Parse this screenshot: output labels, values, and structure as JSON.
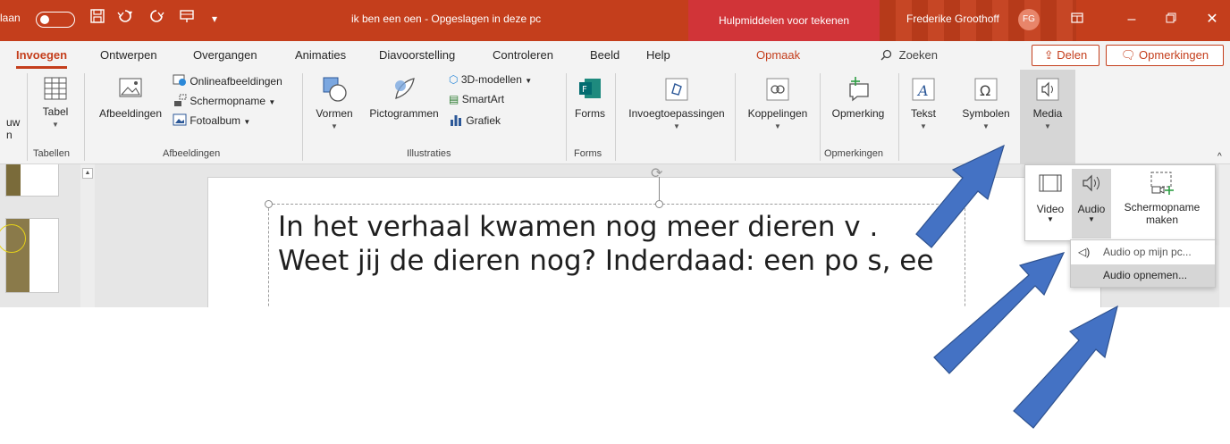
{
  "titlebar": {
    "autosave_label": "laan",
    "doc_title": "ik ben een oen  -  Opgeslagen in deze pc",
    "context_tab": "Hulpmiddelen voor tekenen",
    "user_name": "Frederike Groothoff",
    "user_initials": "FG",
    "icons": [
      "save-icon",
      "undo-icon",
      "redo-icon",
      "present-icon",
      "customize-qat-icon",
      "ribbon-display-icon",
      "minimize-icon",
      "restore-icon",
      "close-icon"
    ],
    "color": "#c43e1c"
  },
  "tabs": [
    "Invoegen",
    "Ontwerpen",
    "Overgangen",
    "Animaties",
    "Diavoorstelling",
    "Controleren",
    "Beeld",
    "Help",
    "Opmaak"
  ],
  "active_tab": "Invoegen",
  "search_label": "Zoeken",
  "share_label": "Delen",
  "comments_label": "Opmerkingen",
  "ribbon": {
    "partial_new_slide": [
      "uw",
      "n"
    ],
    "tabel": "Tabel",
    "group_tabellen": "Tabellen",
    "afbeeldingen": "Afbeeldingen",
    "onlineafbeeldingen": "Onlineafbeeldingen",
    "schermopname": "Schermopname",
    "fotoalbum": "Fotoalbum",
    "group_afbeeldingen": "Afbeeldingen",
    "vormen": "Vormen",
    "pictogrammen": "Pictogrammen",
    "modellen3d": "3D-modellen",
    "smartart": "SmartArt",
    "grafiek": "Grafiek",
    "group_illustraties": "Illustraties",
    "forms": "Forms",
    "group_forms": "Forms",
    "invoegtoepassingen": "Invoegtoepassingen",
    "koppelingen": "Koppelingen",
    "opmerking": "Opmerking",
    "group_opmerkingen": "Opmerkingen",
    "tekst": "Tekst",
    "symbolen": "Symbolen",
    "media": "Media"
  },
  "slide": {
    "line1": "In het verhaal kwamen nog meer dieren v  .",
    "line2": "Weet jij de dieren nog? Inderdaad: een po  s, ee"
  },
  "media_panel": {
    "video": "Video",
    "audio": "Audio",
    "schermopname_line1": "Schermopname",
    "schermopname_line2": "maken"
  },
  "audio_menu": {
    "item1": "Audio op mijn pc...",
    "item2": "Audio opnemen..."
  },
  "annotation_arrow_color": "#4472c4",
  "annotation_arrow_count": 3
}
